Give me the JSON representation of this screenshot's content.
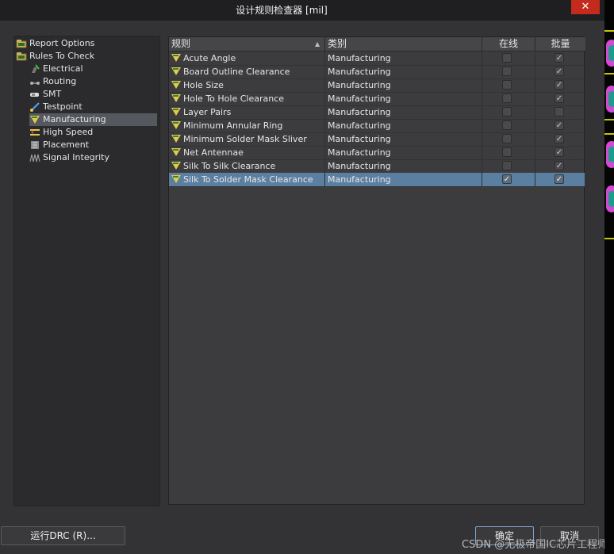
{
  "window": {
    "title": "设计规则检查器 [mil]",
    "close_symbol": "✕"
  },
  "tree": [
    {
      "label": "Report Options",
      "icon": "folder-icon",
      "level": 0,
      "selected": false
    },
    {
      "label": "Rules To Check",
      "icon": "folder-icon",
      "level": 0,
      "selected": false
    },
    {
      "label": "Electrical",
      "icon": "electrical-icon",
      "level": 1,
      "selected": false
    },
    {
      "label": "Routing",
      "icon": "routing-icon",
      "level": 1,
      "selected": false
    },
    {
      "label": "SMT",
      "icon": "smt-icon",
      "level": 1,
      "selected": false
    },
    {
      "label": "Testpoint",
      "icon": "testpoint-icon",
      "level": 1,
      "selected": false
    },
    {
      "label": "Manufacturing",
      "icon": "manufacturing-icon",
      "level": 1,
      "selected": true
    },
    {
      "label": "High Speed",
      "icon": "high-speed-icon",
      "level": 1,
      "selected": false
    },
    {
      "label": "Placement",
      "icon": "placement-icon",
      "level": 1,
      "selected": false
    },
    {
      "label": "Signal Integrity",
      "icon": "signal-integrity-icon",
      "level": 1,
      "selected": false
    }
  ],
  "grid": {
    "headers": {
      "rule": "规则",
      "category": "类别",
      "online": "在线",
      "batch": "批量"
    },
    "sort_symbol": "▲",
    "check_symbol": "✓",
    "rows": [
      {
        "rule": "Acute Angle",
        "category": "Manufacturing",
        "online": false,
        "batch": true,
        "selected": false
      },
      {
        "rule": "Board Outline Clearance",
        "category": "Manufacturing",
        "online": false,
        "batch": true,
        "selected": false
      },
      {
        "rule": "Hole Size",
        "category": "Manufacturing",
        "online": false,
        "batch": true,
        "selected": false
      },
      {
        "rule": "Hole To Hole Clearance",
        "category": "Manufacturing",
        "online": false,
        "batch": true,
        "selected": false
      },
      {
        "rule": "Layer Pairs",
        "category": "Manufacturing",
        "online": false,
        "batch": false,
        "selected": false
      },
      {
        "rule": "Minimum Annular Ring",
        "category": "Manufacturing",
        "online": false,
        "batch": true,
        "selected": false
      },
      {
        "rule": "Minimum Solder Mask Sliver",
        "category": "Manufacturing",
        "online": false,
        "batch": true,
        "selected": false
      },
      {
        "rule": "Net Antennae",
        "category": "Manufacturing",
        "online": false,
        "batch": true,
        "selected": false
      },
      {
        "rule": "Silk To Silk Clearance",
        "category": "Manufacturing",
        "online": false,
        "batch": true,
        "selected": false
      },
      {
        "rule": "Silk To Solder Mask Clearance",
        "category": "Manufacturing",
        "online": true,
        "batch": true,
        "selected": true
      }
    ]
  },
  "buttons": {
    "run_drc": "运行DRC (R)...",
    "ok": "确定",
    "cancel": "取消"
  },
  "watermark": "CSDN @无极帝国IC芯片工程师",
  "colors": {
    "selection": "#5b7fa1",
    "tree_selection": "#55595f",
    "close": "#c42b1c"
  }
}
